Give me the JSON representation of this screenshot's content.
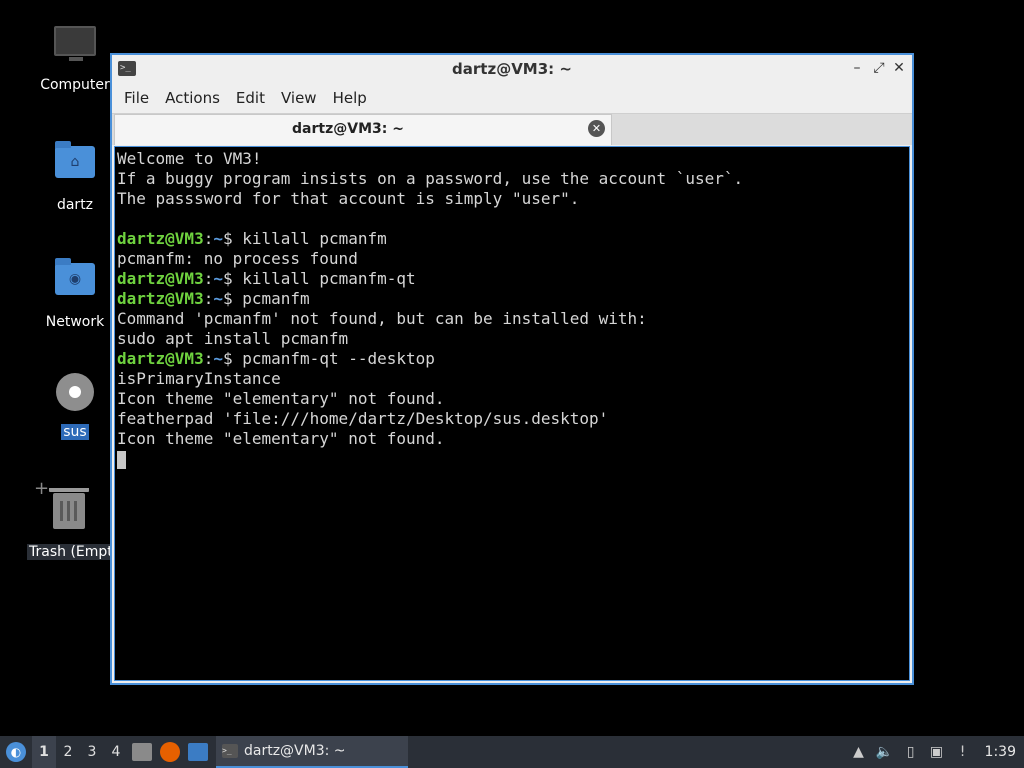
{
  "desktop": {
    "icons": [
      {
        "label": "Computer",
        "icon": "computer-icon"
      },
      {
        "label": "dartz",
        "icon": "home-folder-icon"
      },
      {
        "label": "Network",
        "icon": "network-folder-icon"
      },
      {
        "label": "sus",
        "icon": "settings-gear-icon"
      },
      {
        "label": "Trash (Empty)",
        "icon": "trash-icon"
      }
    ]
  },
  "window": {
    "title": "dartz@VM3: ~",
    "menu": [
      "File",
      "Actions",
      "Edit",
      "View",
      "Help"
    ],
    "tab_label": "dartz@VM3: ~",
    "accent": "#4a90d9"
  },
  "terminal": {
    "prompt_user": "dartz@VM3",
    "prompt_path": "~",
    "lines": [
      {
        "type": "out",
        "text": "Welcome to VM3!"
      },
      {
        "type": "out",
        "text": "If a buggy program insists on a password, use the account `user`."
      },
      {
        "type": "out",
        "text": "The passsword for that account is simply \"user\"."
      },
      {
        "type": "out",
        "text": ""
      },
      {
        "type": "cmd",
        "text": "killall pcmanfm"
      },
      {
        "type": "out",
        "text": "pcmanfm: no process found"
      },
      {
        "type": "cmd",
        "text": "killall pcmanfm-qt"
      },
      {
        "type": "cmd",
        "text": "pcmanfm"
      },
      {
        "type": "out",
        "text": "Command 'pcmanfm' not found, but can be installed with:"
      },
      {
        "type": "out",
        "text": "sudo apt install pcmanfm"
      },
      {
        "type": "cmd",
        "text": "pcmanfm-qt --desktop"
      },
      {
        "type": "out",
        "text": "isPrimaryInstance"
      },
      {
        "type": "out",
        "text": "Icon theme \"elementary\" not found."
      },
      {
        "type": "out",
        "text": "featherpad 'file:///home/dartz/Desktop/sus.desktop'"
      },
      {
        "type": "out",
        "text": "Icon theme \"elementary\" not found."
      }
    ]
  },
  "taskbar": {
    "workspaces": [
      "1",
      "2",
      "3",
      "4"
    ],
    "active_workspace": "1",
    "task_label": "dartz@VM3: ~",
    "clock": "1:39"
  }
}
